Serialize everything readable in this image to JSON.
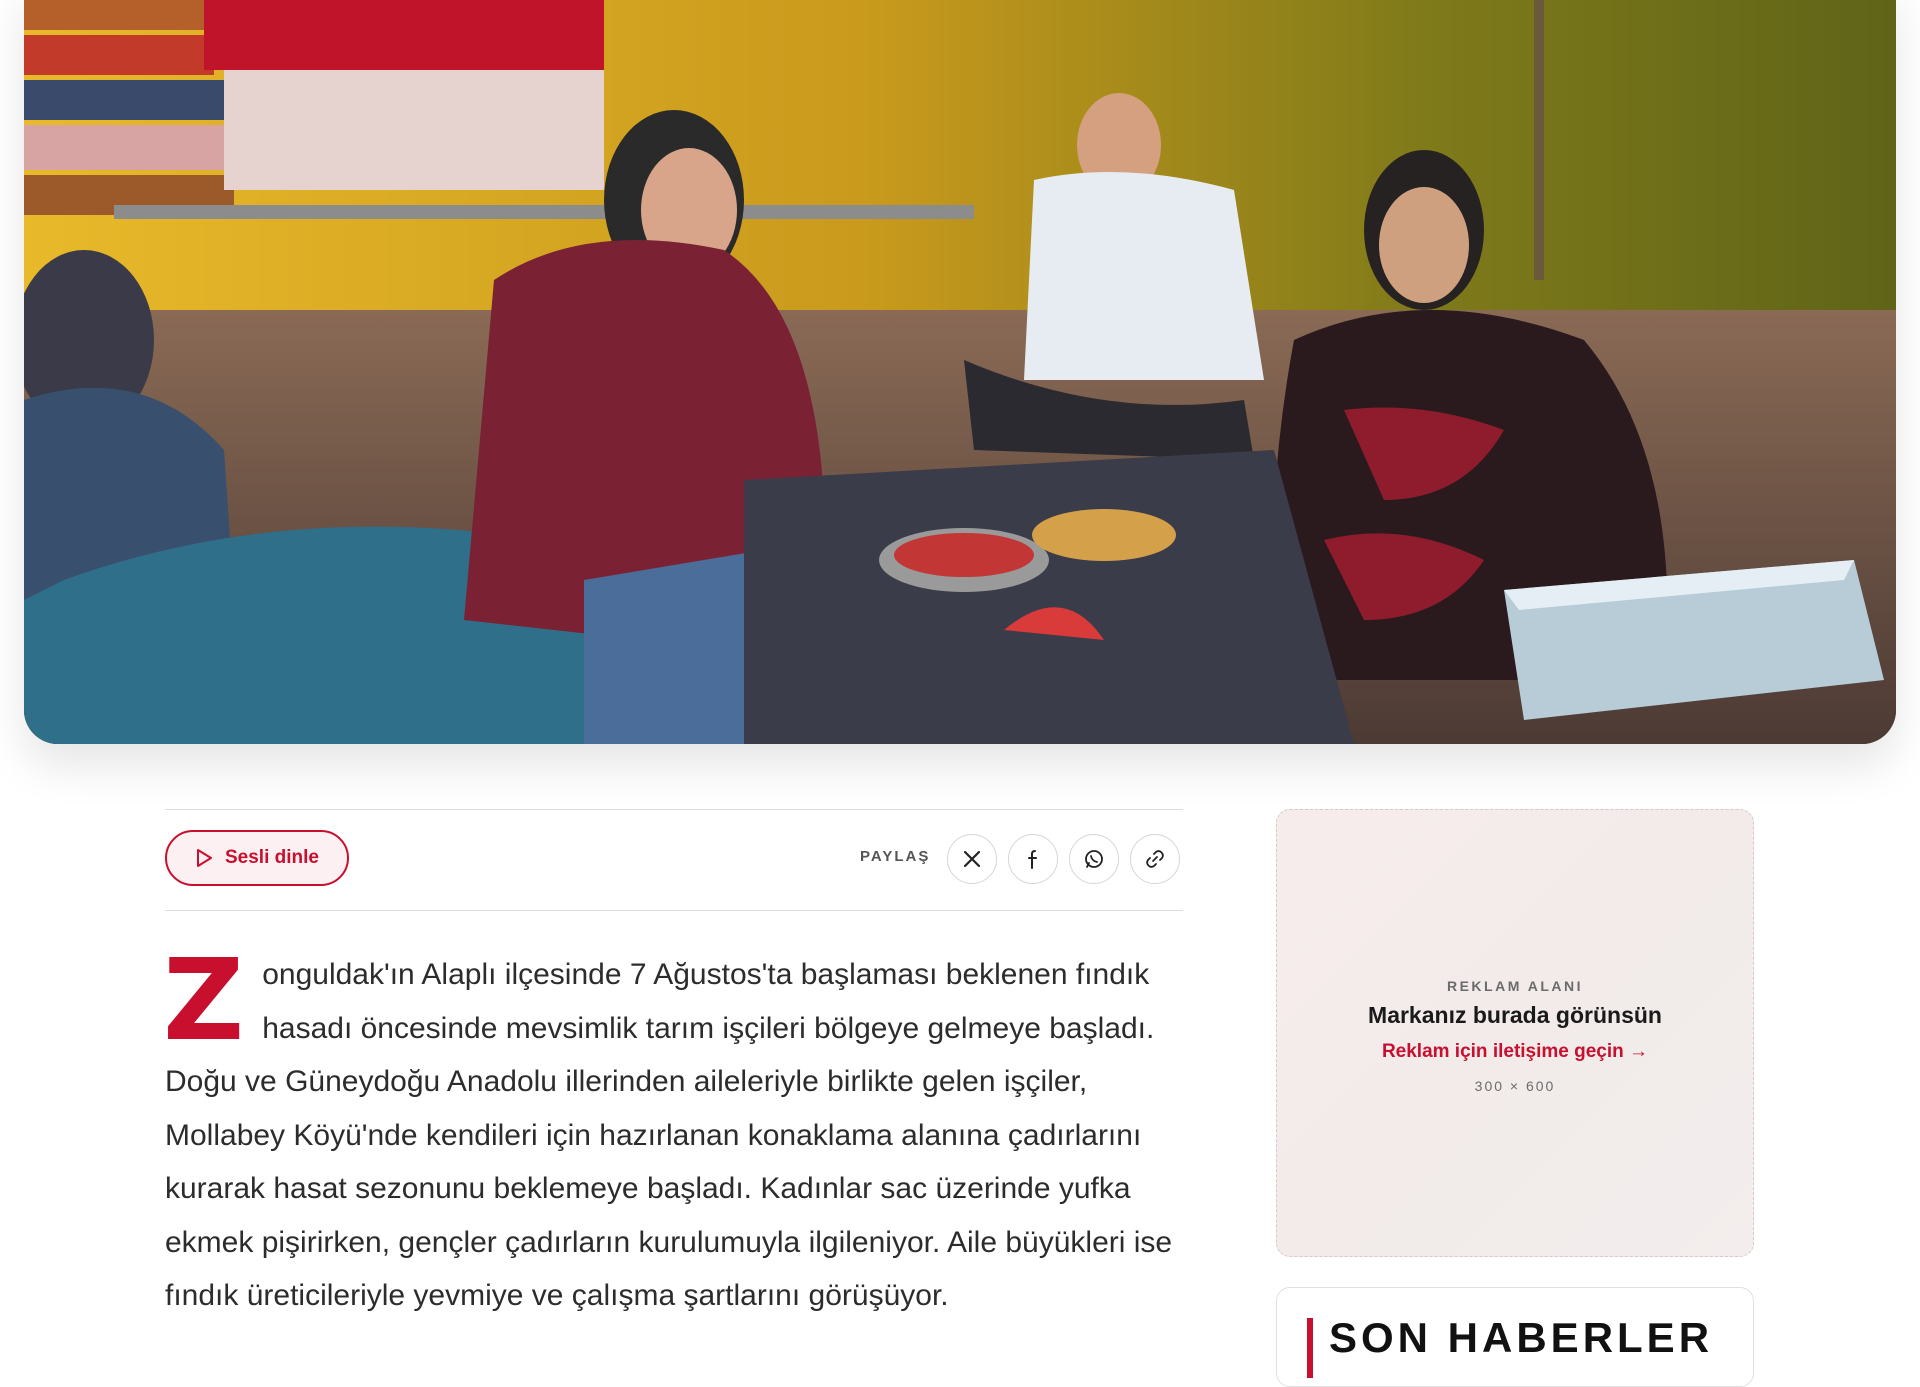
{
  "toolbar": {
    "listen_label": "Sesli dinle",
    "share_label": "PAYLAŞ",
    "share_icons": [
      "x-icon",
      "facebook-icon",
      "whatsapp-icon",
      "link-icon"
    ]
  },
  "article": {
    "dropcap": "Z",
    "body": "onguldak'ın Alaplı ilçesinde 7 Ağustos'ta başlaması beklenen fındık hasadı öncesinde mevsimlik tarım işçileri bölgeye gelmeye başladı. Doğu ve Güneydoğu Anadolu illerinden aileleriyle birlikte gelen işçiler, Mollabey Köyü'nde kendileri için hazırlanan konaklama alanına çadırlarını kurarak hasat sezonunu beklemeye başladı. Kadınlar sac üzerinde yufka ekmek pişirirken, gençler çadırların kurulumuyla ilgileniyor. Aile büyükleri ise fındık üreticileriyle yevmiye ve çalışma şartlarını görüşüyor."
  },
  "ad": {
    "kicker": "REKLAM ALANI",
    "title": "Markanız burada görünsün",
    "cta": "Reklam için iletişime geçin →",
    "size": "300 × 600"
  },
  "sidebar": {
    "news_title": "SON HABERLER"
  },
  "colors": {
    "accent": "#c8102e"
  }
}
